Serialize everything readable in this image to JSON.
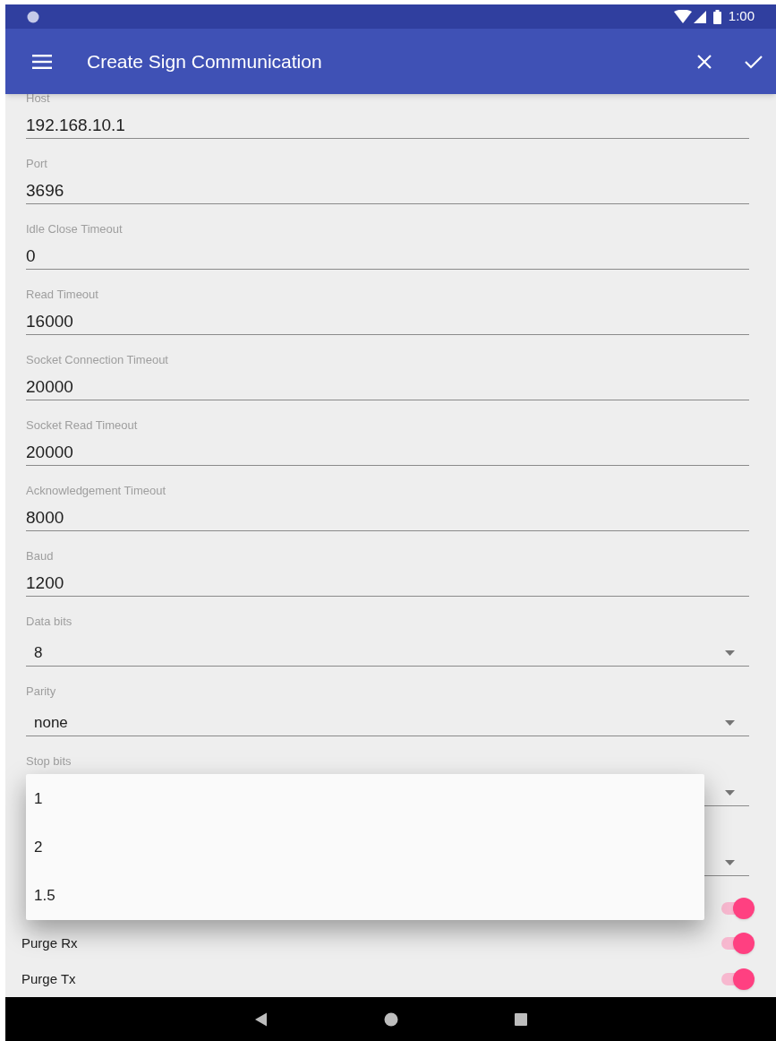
{
  "status_bar": {
    "time": "1:00"
  },
  "app_bar": {
    "title": "Create Sign Communication"
  },
  "fields": [
    {
      "kind": "text",
      "label": "Host",
      "value": "192.168.10.1"
    },
    {
      "kind": "text",
      "label": "Port",
      "value": "3696"
    },
    {
      "kind": "text",
      "label": "Idle Close Timeout",
      "value": "0"
    },
    {
      "kind": "text",
      "label": "Read Timeout",
      "value": "16000"
    },
    {
      "kind": "text",
      "label": "Socket Connection Timeout",
      "value": "20000"
    },
    {
      "kind": "text",
      "label": "Socket Read Timeout",
      "value": "20000"
    },
    {
      "kind": "text",
      "label": "Acknowledgement Timeout",
      "value": "8000"
    },
    {
      "kind": "text",
      "label": "Baud",
      "value": "1200"
    },
    {
      "kind": "dropdown",
      "label": "Data bits",
      "value": "8"
    },
    {
      "kind": "dropdown",
      "label": "Parity",
      "value": "none"
    },
    {
      "kind": "dropdown",
      "label": "Stop bits"
    },
    {
      "kind": "dropdown"
    }
  ],
  "switches": [
    {
      "on": true
    },
    {
      "label": "Purge Rx",
      "on": true
    },
    {
      "label": "Purge Tx",
      "on": true
    }
  ],
  "popup": {
    "options": [
      "1",
      "2",
      "1.5"
    ]
  }
}
